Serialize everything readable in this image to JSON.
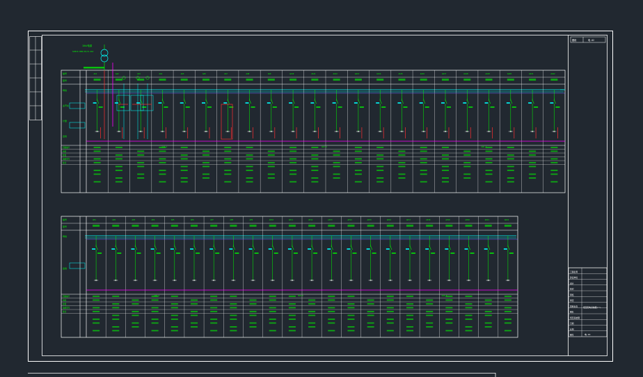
{
  "drawing": {
    "sheet_label": "图纸",
    "sheet_number": "电-02",
    "colors": {
      "background": "#212830",
      "frame": "#ffffff",
      "green": "#00ff00",
      "cyan": "#00ffff",
      "red": "#ff3030",
      "magenta": "#ff00ff",
      "blue": "#6a6aff",
      "yellow": "#ffff00"
    },
    "upper_panel": {
      "source_label": "10kV电源",
      "transformer_label": "SCB10-800/10/0.4kV",
      "column_count": 22,
      "header_rows": [
        "编号",
        "型号"
      ],
      "section_labels": [
        "母线",
        "主开关",
        "计量",
        "出线"
      ],
      "bottom_rows": [
        "回路编号",
        "用途",
        "容量",
        "电缆型号",
        "备注"
      ],
      "cabinet_ids": [
        "AA1",
        "AA2",
        "AA3",
        "AA4",
        "AA5",
        "AA6",
        "AA7",
        "AA8",
        "AA9",
        "AA10",
        "AA11",
        "AA12",
        "AA13",
        "AA14",
        "AA15",
        "AA16",
        "AA17",
        "AA18",
        "AA19",
        "AA20",
        "AA21",
        "AA22"
      ],
      "group_labels": [
        "GGD-1",
        "GGD-2",
        "GGD-3"
      ]
    },
    "lower_panel": {
      "column_count": 22,
      "header_rows": [
        "编号",
        "型号"
      ],
      "section_labels": [
        "母线",
        "出线"
      ],
      "bottom_rows": [
        "回路编号",
        "用途",
        "容量",
        "电缆型号",
        "备注"
      ],
      "cabinet_ids": [
        "AP1",
        "AP2",
        "AP3",
        "AP4",
        "AP5",
        "AP6",
        "AP7",
        "AP8",
        "AP9",
        "AP10",
        "AP11",
        "AP12",
        "AP13",
        "AP14",
        "AP15",
        "AP16",
        "AP17",
        "AP18",
        "AP19",
        "AP20",
        "AP21",
        "AP22"
      ],
      "group_labels": [
        "GGD-4",
        "GGD-5",
        "GGD-6"
      ]
    },
    "title_block": {
      "rows": [
        "工程名称",
        "建设单位",
        "设计",
        "校对",
        "审核",
        "审定",
        "项目负责",
        "图名",
        "低压系统图",
        "日期",
        "比例",
        "图号"
      ],
      "drawing_title": "低压配电系统图(一)",
      "drawing_number": "电-03"
    }
  }
}
